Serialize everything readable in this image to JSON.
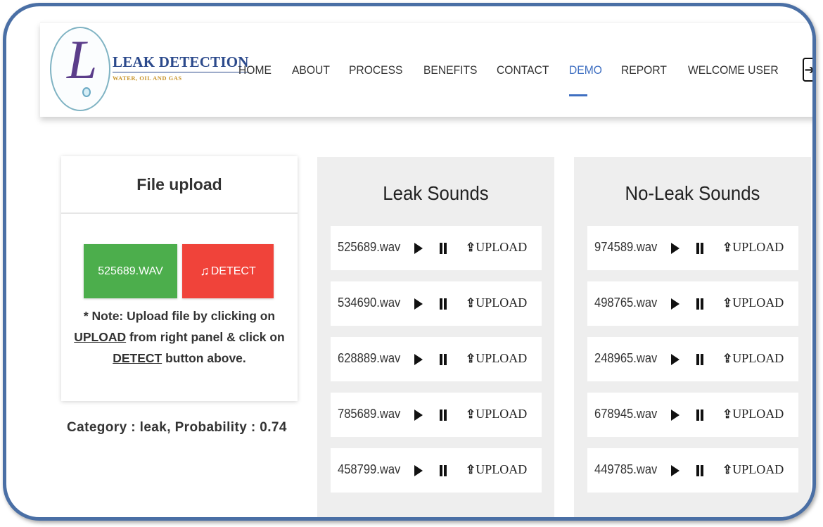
{
  "brand": {
    "title": "LEAK DETECTION",
    "subtitle": "WATER, OIL AND GAS",
    "logo_letter": "L"
  },
  "nav": {
    "items": [
      "HOME",
      "ABOUT",
      "PROCESS",
      "BENEFITS",
      "CONTACT",
      "DEMO",
      "REPORT",
      "WELCOME USER"
    ],
    "active": "DEMO",
    "logout_icon": "logout-icon"
  },
  "upload_card": {
    "title": "File upload",
    "file_button": "525689.WAV",
    "detect_button": "DETECT",
    "detect_icon": "music-note-icon",
    "note_prefix": "* Note: Upload file by clicking on",
    "note_link1": "UPLOAD",
    "note_mid": " from right panel & click on",
    "note_link2": "DETECT",
    "note_suffix": " button above."
  },
  "result": "Category : leak, Probability : 0.74",
  "leak_panel": {
    "title": "Leak Sounds",
    "files": [
      "525689.wav",
      "534690.wav",
      "628889.wav",
      "785689.wav",
      "458799.wav"
    ]
  },
  "noleak_panel": {
    "title": "No-Leak Sounds",
    "files": [
      "974589.wav",
      "498765.wav",
      "248965.wav",
      "678945.wav",
      "449785.wav"
    ]
  },
  "row_actions": {
    "upload_label": "UPLOAD",
    "upload_glyph": "⇪",
    "play_icon": "play-icon",
    "pause_icon": "pause-icon"
  },
  "colors": {
    "accent": "#3f6fc1",
    "file_button": "#4cae4c",
    "detect_button": "#f0433a",
    "frame": "#4a6fa5"
  }
}
